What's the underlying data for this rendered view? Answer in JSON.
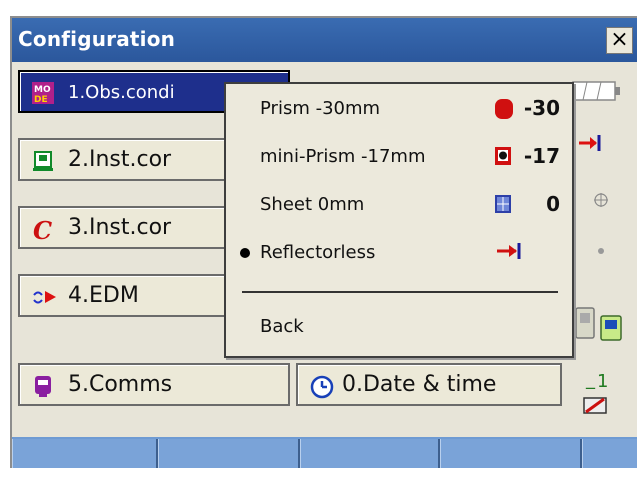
{
  "window": {
    "title": "Configuration",
    "close_label": "×"
  },
  "menu": [
    {
      "label": "1.Obs.condi",
      "icon": "mode-icon"
    },
    {
      "label": "2.Inst.cor",
      "icon": "instrument-icon"
    },
    {
      "label": "3.Inst.cor",
      "icon": "c-constant-icon"
    },
    {
      "label": "4.EDM",
      "icon": "edm-icon"
    },
    {
      "label": "5.Comms",
      "icon": "comms-icon"
    },
    {
      "label": "0.Date & time",
      "icon": "clock-icon"
    }
  ],
  "popup": {
    "items": [
      {
        "label": "Prism -30mm",
        "constant": "-30",
        "icon": "prism-icon",
        "selected": false
      },
      {
        "label": "mini-Prism -17mm",
        "constant": "-17",
        "icon": "mini-prism-icon",
        "selected": false
      },
      {
        "label": "Sheet 0mm",
        "constant": "0",
        "icon": "sheet-icon",
        "selected": false
      },
      {
        "label": "Reflectorless",
        "constant": "",
        "icon": "reflectorless-icon",
        "selected": true
      }
    ],
    "back_label": "Back"
  },
  "status": {
    "battery_icon": "battery-icon",
    "target_icon": "target-icon",
    "compensator_icon": "tilt-icon",
    "laser_icon": "laser-dot-icon",
    "comm_icon": "bluetooth-device-icon",
    "page_number": "1",
    "memory_icon": "memory-card-icon"
  },
  "colors": {
    "title_bar": "#2e5fa6",
    "selected_button": "#1e2f8c",
    "softkey_bar": "#6f9bd3",
    "accent_red": "#d01010"
  }
}
